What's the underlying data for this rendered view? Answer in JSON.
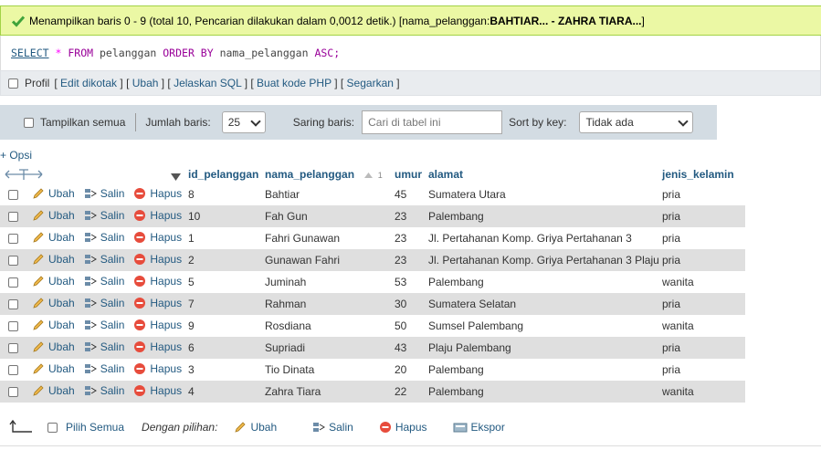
{
  "success": {
    "message": "Menampilkan baris 0 - 9 (total 10, Pencarian dilakukan dalam 0,0012 detik.) [nama_pelanggan: ",
    "range": "BAHTIAR... - ZAHRA TIARA...",
    "suffix": "]"
  },
  "sql": {
    "select": "SELECT",
    "star": "*",
    "from": "FROM",
    "table": "pelanggan",
    "order_by": "ORDER BY",
    "column": "nama_pelanggan",
    "asc": "ASC;"
  },
  "sqltools": {
    "profil": "Profil",
    "links": [
      "Edit dikotak",
      "Ubah",
      "Jelaskan SQL",
      "Buat kode PHP",
      "Segarkan"
    ]
  },
  "navbar": {
    "show_all": "Tampilkan semua",
    "rows_label": "Jumlah baris:",
    "rows_value": "25",
    "filter_label": "Saring baris:",
    "filter_placeholder": "Cari di tabel ini",
    "sort_label": "Sort by key:",
    "sort_value": "Tidak ada"
  },
  "opsi": "+ Opsi",
  "table": {
    "headers": {
      "id": "id_pelanggan",
      "nama": "nama_pelanggan",
      "sort_index": "1",
      "umur": "umur",
      "alamat": "alamat",
      "jk": "jenis_kelamin"
    },
    "action_labels": {
      "edit": "Ubah",
      "copy": "Salin",
      "delete": "Hapus"
    },
    "rows": [
      {
        "id": "8",
        "nama": "Bahtiar",
        "umur": "45",
        "alamat": "Sumatera Utara",
        "jk": "pria"
      },
      {
        "id": "10",
        "nama": "Fah Gun",
        "umur": "23",
        "alamat": "Palembang",
        "jk": "pria"
      },
      {
        "id": "1",
        "nama": "Fahri Gunawan",
        "umur": "23",
        "alamat": "Jl. Pertahanan Komp. Griya Pertahanan 3",
        "jk": "pria"
      },
      {
        "id": "2",
        "nama": "Gunawan Fahri",
        "umur": "23",
        "alamat": "Jl. Pertahanan Komp. Griya Pertahanan 3 Plaju",
        "jk": "pria"
      },
      {
        "id": "5",
        "nama": "Juminah",
        "umur": "53",
        "alamat": "Palembang",
        "jk": "wanita"
      },
      {
        "id": "7",
        "nama": "Rahman",
        "umur": "30",
        "alamat": "Sumatera Selatan",
        "jk": "pria"
      },
      {
        "id": "9",
        "nama": "Rosdiana",
        "umur": "50",
        "alamat": "Sumsel Palembang",
        "jk": "wanita"
      },
      {
        "id": "6",
        "nama": "Supriadi",
        "umur": "43",
        "alamat": "Plaju Palembang",
        "jk": "pria"
      },
      {
        "id": "3",
        "nama": "Tio Dinata",
        "umur": "20",
        "alamat": "Palembang",
        "jk": "pria"
      },
      {
        "id": "4",
        "nama": "Zahra Tiara",
        "umur": "22",
        "alamat": "Palembang",
        "jk": "wanita"
      }
    ]
  },
  "footer": {
    "select_all": "Pilih Semua",
    "with_selected": "Dengan pilihan:",
    "edit": "Ubah",
    "copy": "Salin",
    "delete": "Hapus",
    "export": "Ekspor"
  },
  "colors": {
    "success_bg": "#ebf8a4",
    "link": "#235a81",
    "row_even": "#dfdfdf",
    "navbar_bg": "#d3dce3",
    "delete_red": "#e74c3c"
  }
}
